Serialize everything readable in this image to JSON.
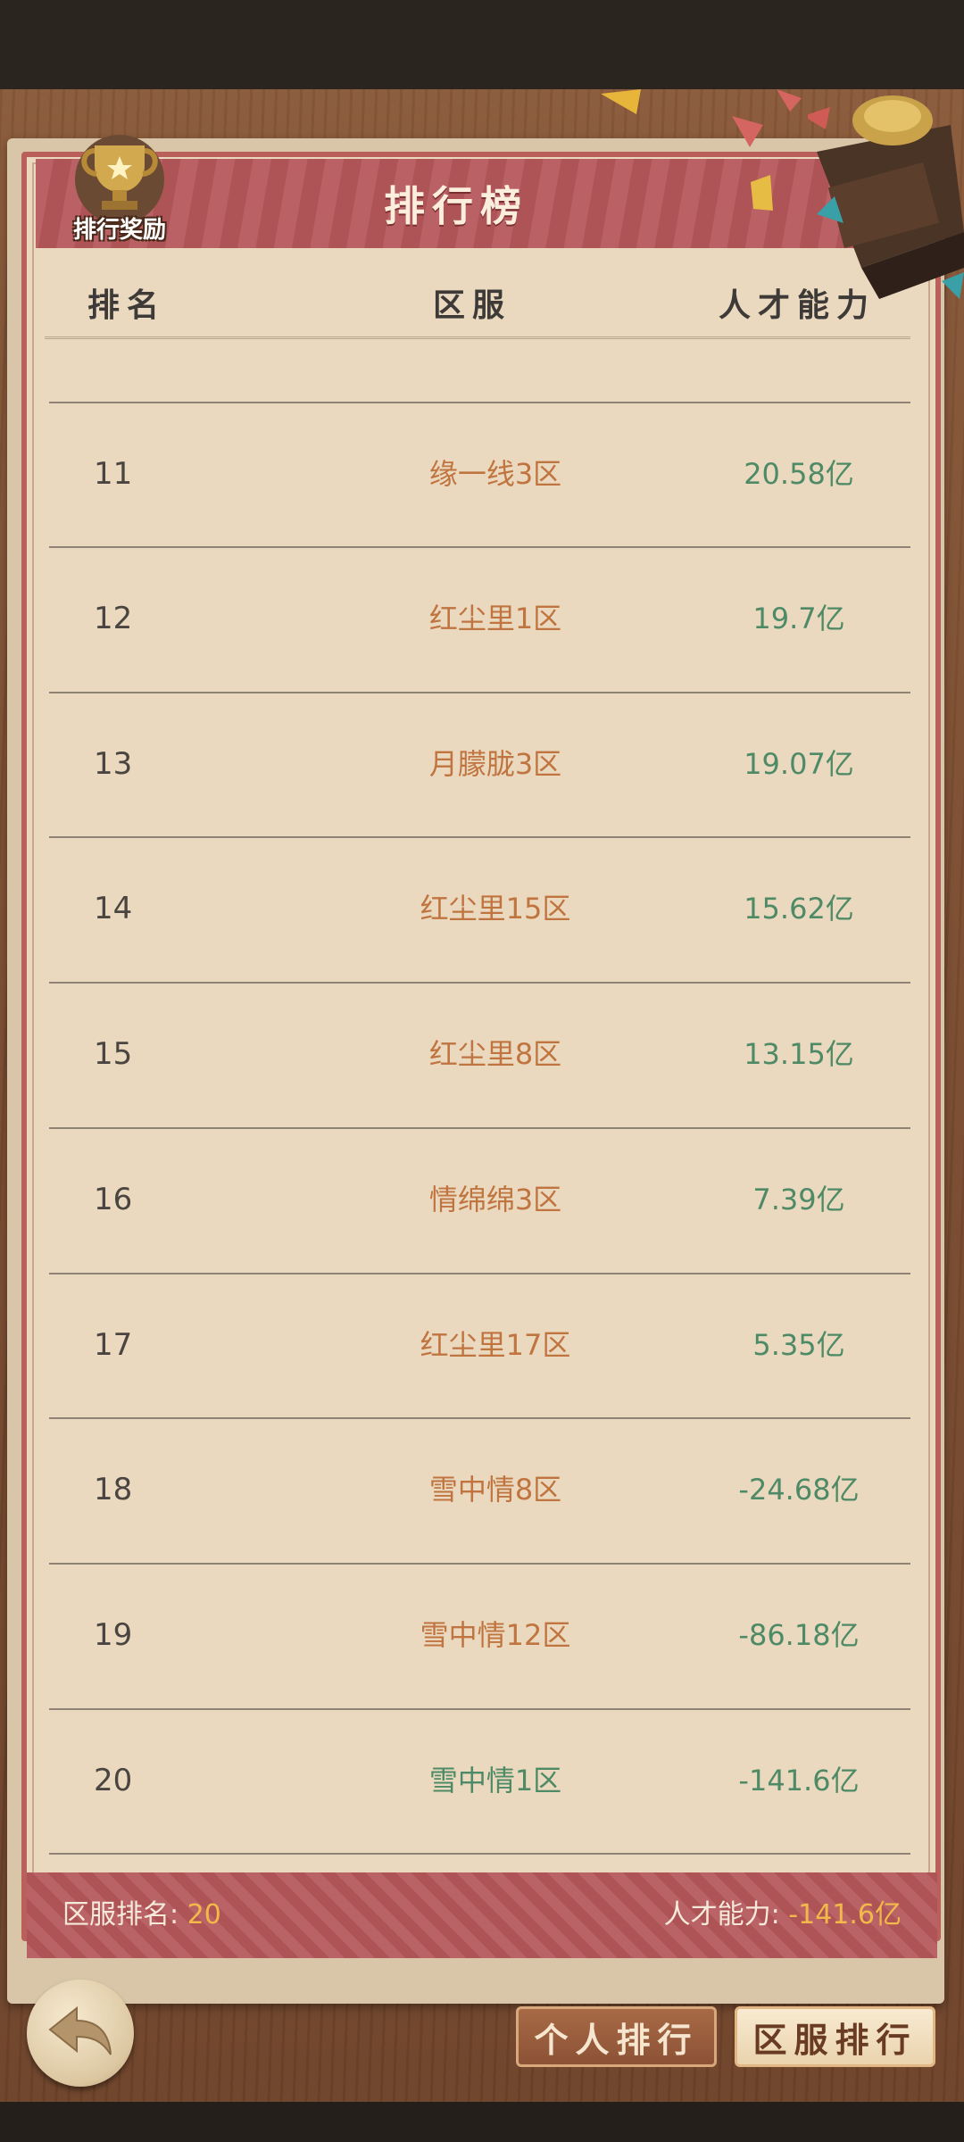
{
  "title": "排行榜",
  "reward_label": "排行奖励",
  "columns": {
    "rank": "排名",
    "server": "区服",
    "power": "人才能力"
  },
  "rows": [
    {
      "rank": "11",
      "server": "缘一线3区",
      "power": "20.58亿"
    },
    {
      "rank": "12",
      "server": "红尘里1区",
      "power": "19.7亿"
    },
    {
      "rank": "13",
      "server": "月朦胧3区",
      "power": "19.07亿"
    },
    {
      "rank": "14",
      "server": "红尘里15区",
      "power": "15.62亿"
    },
    {
      "rank": "15",
      "server": "红尘里8区",
      "power": "13.15亿"
    },
    {
      "rank": "16",
      "server": "情绵绵3区",
      "power": "7.39亿"
    },
    {
      "rank": "17",
      "server": "红尘里17区",
      "power": "5.35亿"
    },
    {
      "rank": "18",
      "server": "雪中情8区",
      "power": "-24.68亿"
    },
    {
      "rank": "19",
      "server": "雪中情12区",
      "power": "-86.18亿"
    },
    {
      "rank": "20",
      "server": "雪中情1区",
      "power": "-141.6亿"
    }
  ],
  "footer": {
    "server_rank_label": "区服排名: ",
    "server_rank_value": "20",
    "power_label": "人才能力: ",
    "power_value": "-141.6亿"
  },
  "tabs": {
    "personal": "个人排行",
    "server": "区服排行"
  },
  "icons": {
    "reward": "trophy-icon",
    "back": "back-arrow-icon",
    "decoration": "trophy-statue-icon"
  },
  "colors": {
    "server_text": "#c07540",
    "own_server_text": "#4f8a66",
    "power_text": "#4f8a66",
    "accent": "#f2b94a",
    "banner": "#b5575a"
  }
}
